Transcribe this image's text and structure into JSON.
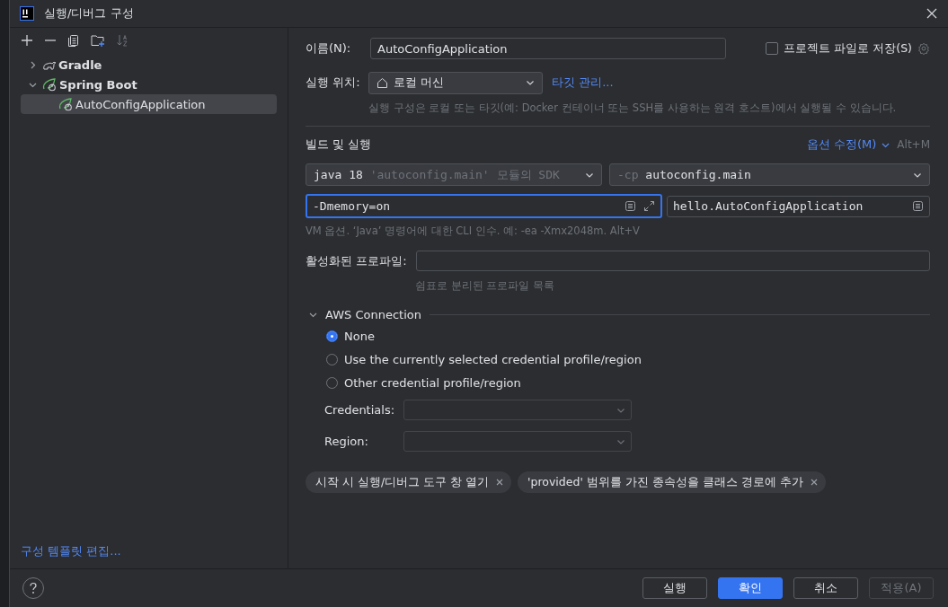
{
  "window": {
    "title": "실행/디버그 구성"
  },
  "tree": [
    {
      "label": "Gradle",
      "kind": "gradle",
      "expanded": false,
      "selected": false
    },
    {
      "label": "Spring Boot",
      "kind": "spring",
      "expanded": true,
      "selected": false,
      "children": [
        {
          "label": "AutoConfigApplication",
          "kind": "spring-app",
          "selected": true
        }
      ]
    }
  ],
  "edit_templates_link": "구성 템플릿 편집...",
  "name_field": {
    "label": "이름(N):",
    "value": "AutoConfigApplication"
  },
  "store_as_project_file": {
    "label": "프로젝트 파일로 저장(S)",
    "checked": false
  },
  "run_on": {
    "label": "실행 위치:",
    "value": "로컬 머신",
    "link": "타깃 관리...",
    "hint": "실행 구성은 로컬 또는 타깃(예: Docker 컨테이너 또는 SSH를 사용하는 원격 호스트)에서 실행될 수 있습니다."
  },
  "build_and_run": {
    "title": "빌드 및 실행",
    "modify_options": "옵션 수정(M)",
    "shortcut": "Alt+M",
    "sdk": {
      "value": "java 18",
      "detail": "'autoconfig.main' 모듈의 SDK"
    },
    "classpath": {
      "prefix": "-cp",
      "value": "autoconfig.main"
    },
    "vm_options": {
      "value": "-Dmemory=on",
      "focused": true
    },
    "main_class": {
      "value": "hello.AutoConfigApplication"
    },
    "vm_hint": "VM 옵션. ‘Java’ 명령어에 대한 CLI 인수. 예: -ea -Xmx2048m. Alt+V"
  },
  "active_profiles": {
    "label": "활성화된 프로파일:",
    "hint": "쉼표로 분리된 프로파일 목록"
  },
  "aws": {
    "title": "AWS Connection",
    "expanded": true,
    "options": [
      {
        "label": "None",
        "selected": true
      },
      {
        "label": "Use the currently selected credential profile/region",
        "selected": false
      },
      {
        "label": "Other credential profile/region",
        "selected": false
      }
    ],
    "credentials": {
      "label": "Credentials:"
    },
    "region": {
      "label": "Region:"
    }
  },
  "tags": [
    {
      "label": "시작 시 실행/디버그 도구 창 열기"
    },
    {
      "label": "'provided' 범위를 가진 종속성을 클래스 경로에 추가"
    }
  ],
  "buttons": [
    {
      "label": "실행",
      "kind": "normal"
    },
    {
      "label": "확인",
      "kind": "primary"
    },
    {
      "label": "취소",
      "kind": "normal"
    },
    {
      "label": "적용(A)",
      "kind": "disabled"
    }
  ]
}
